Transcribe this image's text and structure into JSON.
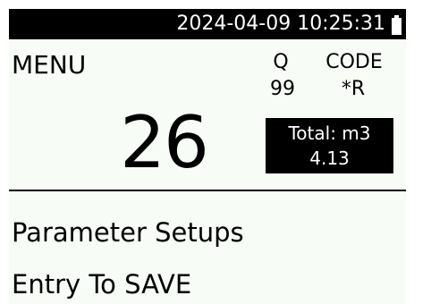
{
  "status_bar": {
    "datetime": "2024-04-09 10:25:31",
    "battery_icon": "battery-full-icon"
  },
  "header": {
    "menu_label": "MENU"
  },
  "readings": {
    "q_label": "Q",
    "q_value": "99",
    "code_label": "CODE",
    "code_value": "*R",
    "big_value": "26"
  },
  "total": {
    "label": "Total: m3",
    "value": "4.13"
  },
  "bottom": {
    "line1": "Parameter Setups",
    "line2": "Entry To SAVE"
  },
  "colors": {
    "background": "#f7fcf7",
    "foreground": "#000000",
    "inverse_text": "#ffffff"
  }
}
